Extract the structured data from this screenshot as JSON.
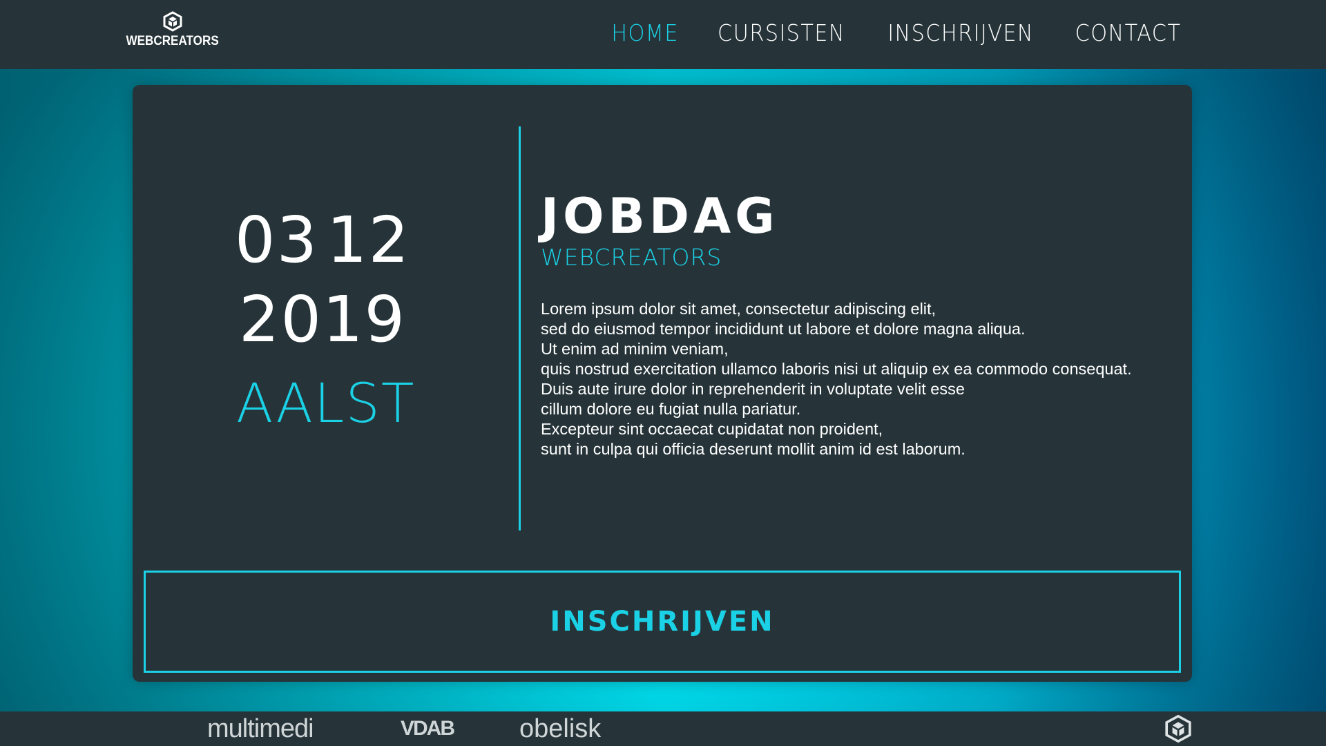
{
  "header": {
    "logo_text": "WEBCREATORS",
    "nav": [
      {
        "label": "HOME",
        "active": true
      },
      {
        "label": "CURSISTEN",
        "active": false
      },
      {
        "label": "INSCHRIJVEN",
        "active": false
      },
      {
        "label": "CONTACT",
        "active": false
      }
    ]
  },
  "event": {
    "day": "03",
    "month": "12",
    "year": "2019",
    "city": "AALST",
    "title": "JOBDAG",
    "subtitle": "WEBCREATORS",
    "description_lines": [
      "Lorem ipsum dolor sit amet, consectetur adipiscing elit,",
      "sed do eiusmod tempor incididunt ut labore et dolore magna aliqua.",
      "Ut enim ad minim veniam,",
      "quis nostrud exercitation ullamco laboris nisi ut aliquip ex ea commodo consequat.",
      "Duis aute irure dolor in reprehenderit in voluptate velit esse",
      "cillum dolore eu fugiat nulla pariatur.",
      "Excepteur sint occaecat cupidatat non proident,",
      "sunt in culpa qui officia deserunt mollit anim id est laborum."
    ],
    "cta_label": "INSCHRIJVEN"
  },
  "footer": {
    "partners": [
      "multimedi",
      "VDAB",
      "obelisk"
    ],
    "icon": "cube-logo-icon"
  },
  "colors": {
    "accent": "#1bd1e6",
    "panel": "#263439",
    "text": "#ffffff"
  }
}
